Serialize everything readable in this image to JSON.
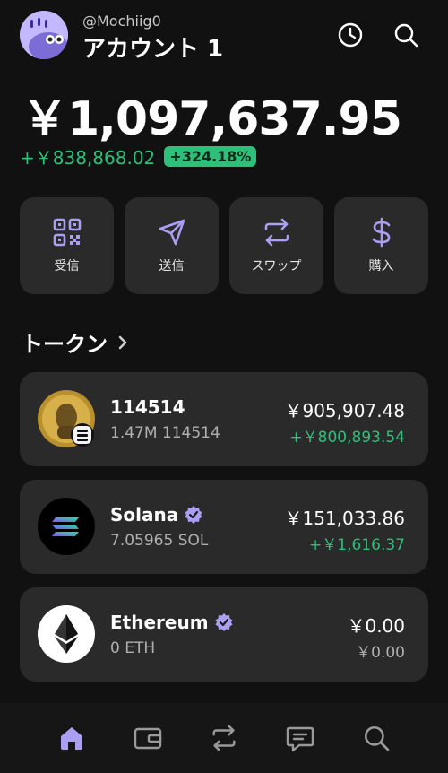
{
  "colors": {
    "accent": "#ab9ff2",
    "positive": "#2ec07a",
    "card": "#2a2a2a",
    "background": "#111111"
  },
  "header": {
    "handle": "@Mochiig0",
    "account_name": "アカウント 1",
    "icons": [
      "history-icon",
      "search-icon"
    ]
  },
  "portfolio": {
    "balance": "￥1,097,637.95",
    "change_amount": "+￥838,868.02",
    "change_percent": "+324.18%"
  },
  "actions": [
    {
      "label": "受信",
      "icon": "qr-code-icon"
    },
    {
      "label": "送信",
      "icon": "send-icon"
    },
    {
      "label": "スワップ",
      "icon": "swap-icon"
    },
    {
      "label": "購入",
      "icon": "dollar-icon"
    }
  ],
  "tokens_section": {
    "title": "トークン"
  },
  "tokens": [
    {
      "name": "114514",
      "quantity": "1.47M 114514",
      "value": "￥905,907.48",
      "change": "+￥800,893.54",
      "verified": false
    },
    {
      "name": "Solana",
      "quantity": "7.05965 SOL",
      "value": "￥151,033.86",
      "change": "+￥1,616.37",
      "verified": true
    },
    {
      "name": "Ethereum",
      "quantity": "0 ETH",
      "value": "￥0.00",
      "change": "￥0.00",
      "verified": true
    }
  ],
  "bottom_nav": [
    "home-icon",
    "wallet-icon",
    "swap-icon",
    "chat-icon",
    "search-icon"
  ]
}
